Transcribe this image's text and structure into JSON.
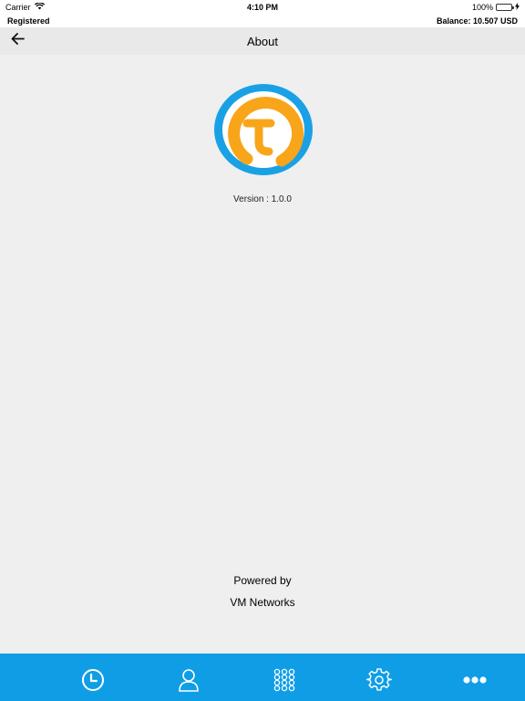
{
  "status_bar": {
    "carrier": "Carrier",
    "time": "4:10 PM",
    "battery": "100%"
  },
  "account_bar": {
    "status": "Registered",
    "balance": "Balance: 10.507 USD"
  },
  "nav": {
    "title": "About"
  },
  "about": {
    "version": "Version : 1.0.0",
    "powered_by": "Powered by",
    "company": "VM Networks"
  },
  "tabs": [
    {
      "icon": "clock-icon"
    },
    {
      "icon": "person-icon"
    },
    {
      "icon": "dialpad-icon"
    },
    {
      "icon": "gear-icon"
    },
    {
      "icon": "more-icon"
    }
  ],
  "colors": {
    "tab_bar": "#0f9ee6",
    "logo_ring": "#1aa1e5",
    "logo_mark": "#f9a51a",
    "background": "#efefef"
  }
}
